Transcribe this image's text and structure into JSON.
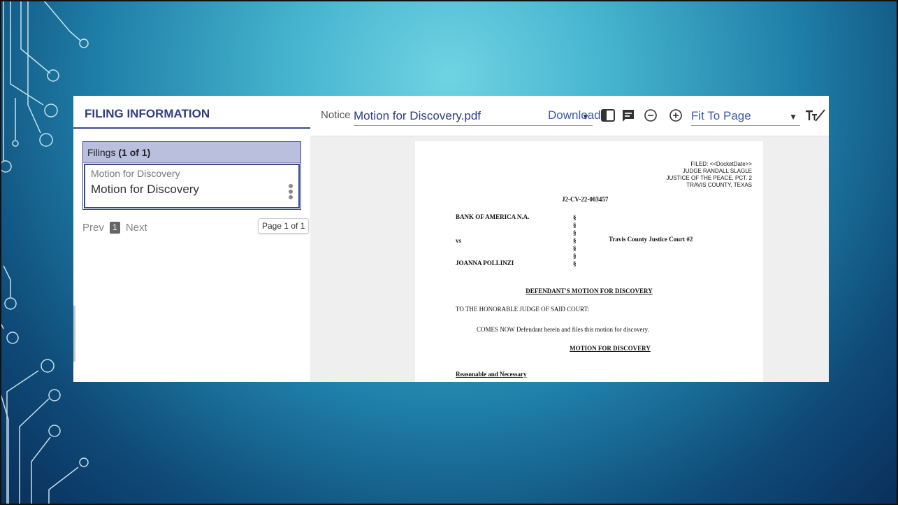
{
  "left_panel": {
    "header": "FILING INFORMATION",
    "filings_label": "Filings",
    "filings_count": "(1 of 1)",
    "filing_item": {
      "type": "Motion for Discovery",
      "title": "Motion for Discovery"
    },
    "pager": {
      "prev": "Prev",
      "page": "1",
      "next": "Next"
    },
    "page_count": "Page 1 of 1"
  },
  "toolbar": {
    "doc_type": "Notice",
    "file_name": "Motion for Discovery.pdf",
    "download": "Download",
    "zoom": "Fit To Page",
    "icons": [
      "sidebar-toggle-icon",
      "comments-icon",
      "zoom-out-icon",
      "zoom-in-icon",
      "text-size-icon",
      "draw-line-icon"
    ]
  },
  "document": {
    "filed_block": [
      "FILED: <<DocketDate>>",
      "JUDGE RANDALL SLAGLE",
      "JUSTICE OF THE PEACE, PCT. 2",
      "TRAVIS COUNTY, TEXAS"
    ],
    "case_number": "J2-CV-22-003457",
    "plaintiff": "BANK OF AMERICA N.A.",
    "versus": "vs",
    "defendant": "JOANNA POLLINZI",
    "section_mark": "§",
    "court": "Travis County Justice Court #2",
    "title": "DEFENDANT'S MOTION FOR DISCOVERY",
    "salutation": "TO THE HONORABLE JUDGE OF SAID COURT:",
    "intro": "COMES NOW Defendant herein and files this motion for discovery.",
    "section_title": "MOTION FOR DISCOVERY",
    "subheading": "Reasonable and Necessary"
  },
  "colors": {
    "brand_navy": "#2e3c84",
    "link_blue": "#3b5ab0",
    "filings_header_bg": "#b9bfdc"
  }
}
